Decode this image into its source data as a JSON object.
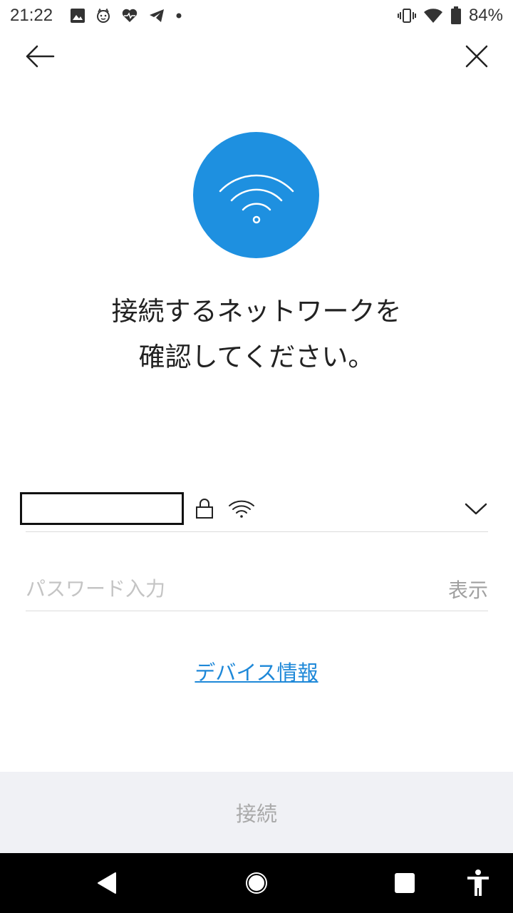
{
  "status_bar": {
    "time": "21:22",
    "left_icons": [
      "image-icon",
      "cat-face-icon",
      "heart-pulse-icon",
      "telegram-icon",
      "dot-icon"
    ],
    "right_icons": [
      "vibrate-icon",
      "wifi-icon",
      "battery-icon"
    ],
    "battery_percent": "84%"
  },
  "header": {
    "back_icon": "arrow-left-icon",
    "close_icon": "close-icon"
  },
  "hero": {
    "icon": "wifi-icon",
    "color": "#1e90e0"
  },
  "headline": {
    "line1": "接続するネットワークを",
    "line2": "確認してください。"
  },
  "network": {
    "ssid": "",
    "lock_icon": "lock-icon",
    "signal_icon": "wifi-icon",
    "dropdown_icon": "chevron-down-icon"
  },
  "password": {
    "placeholder": "パスワード入力",
    "value": "",
    "show_label": "表示"
  },
  "device_info_link": "デバイス情報",
  "connect_button": "接続",
  "nav_bar": {
    "icons": [
      "back-triangle-icon",
      "home-circle-icon",
      "recents-square-icon",
      "accessibility-icon"
    ]
  }
}
